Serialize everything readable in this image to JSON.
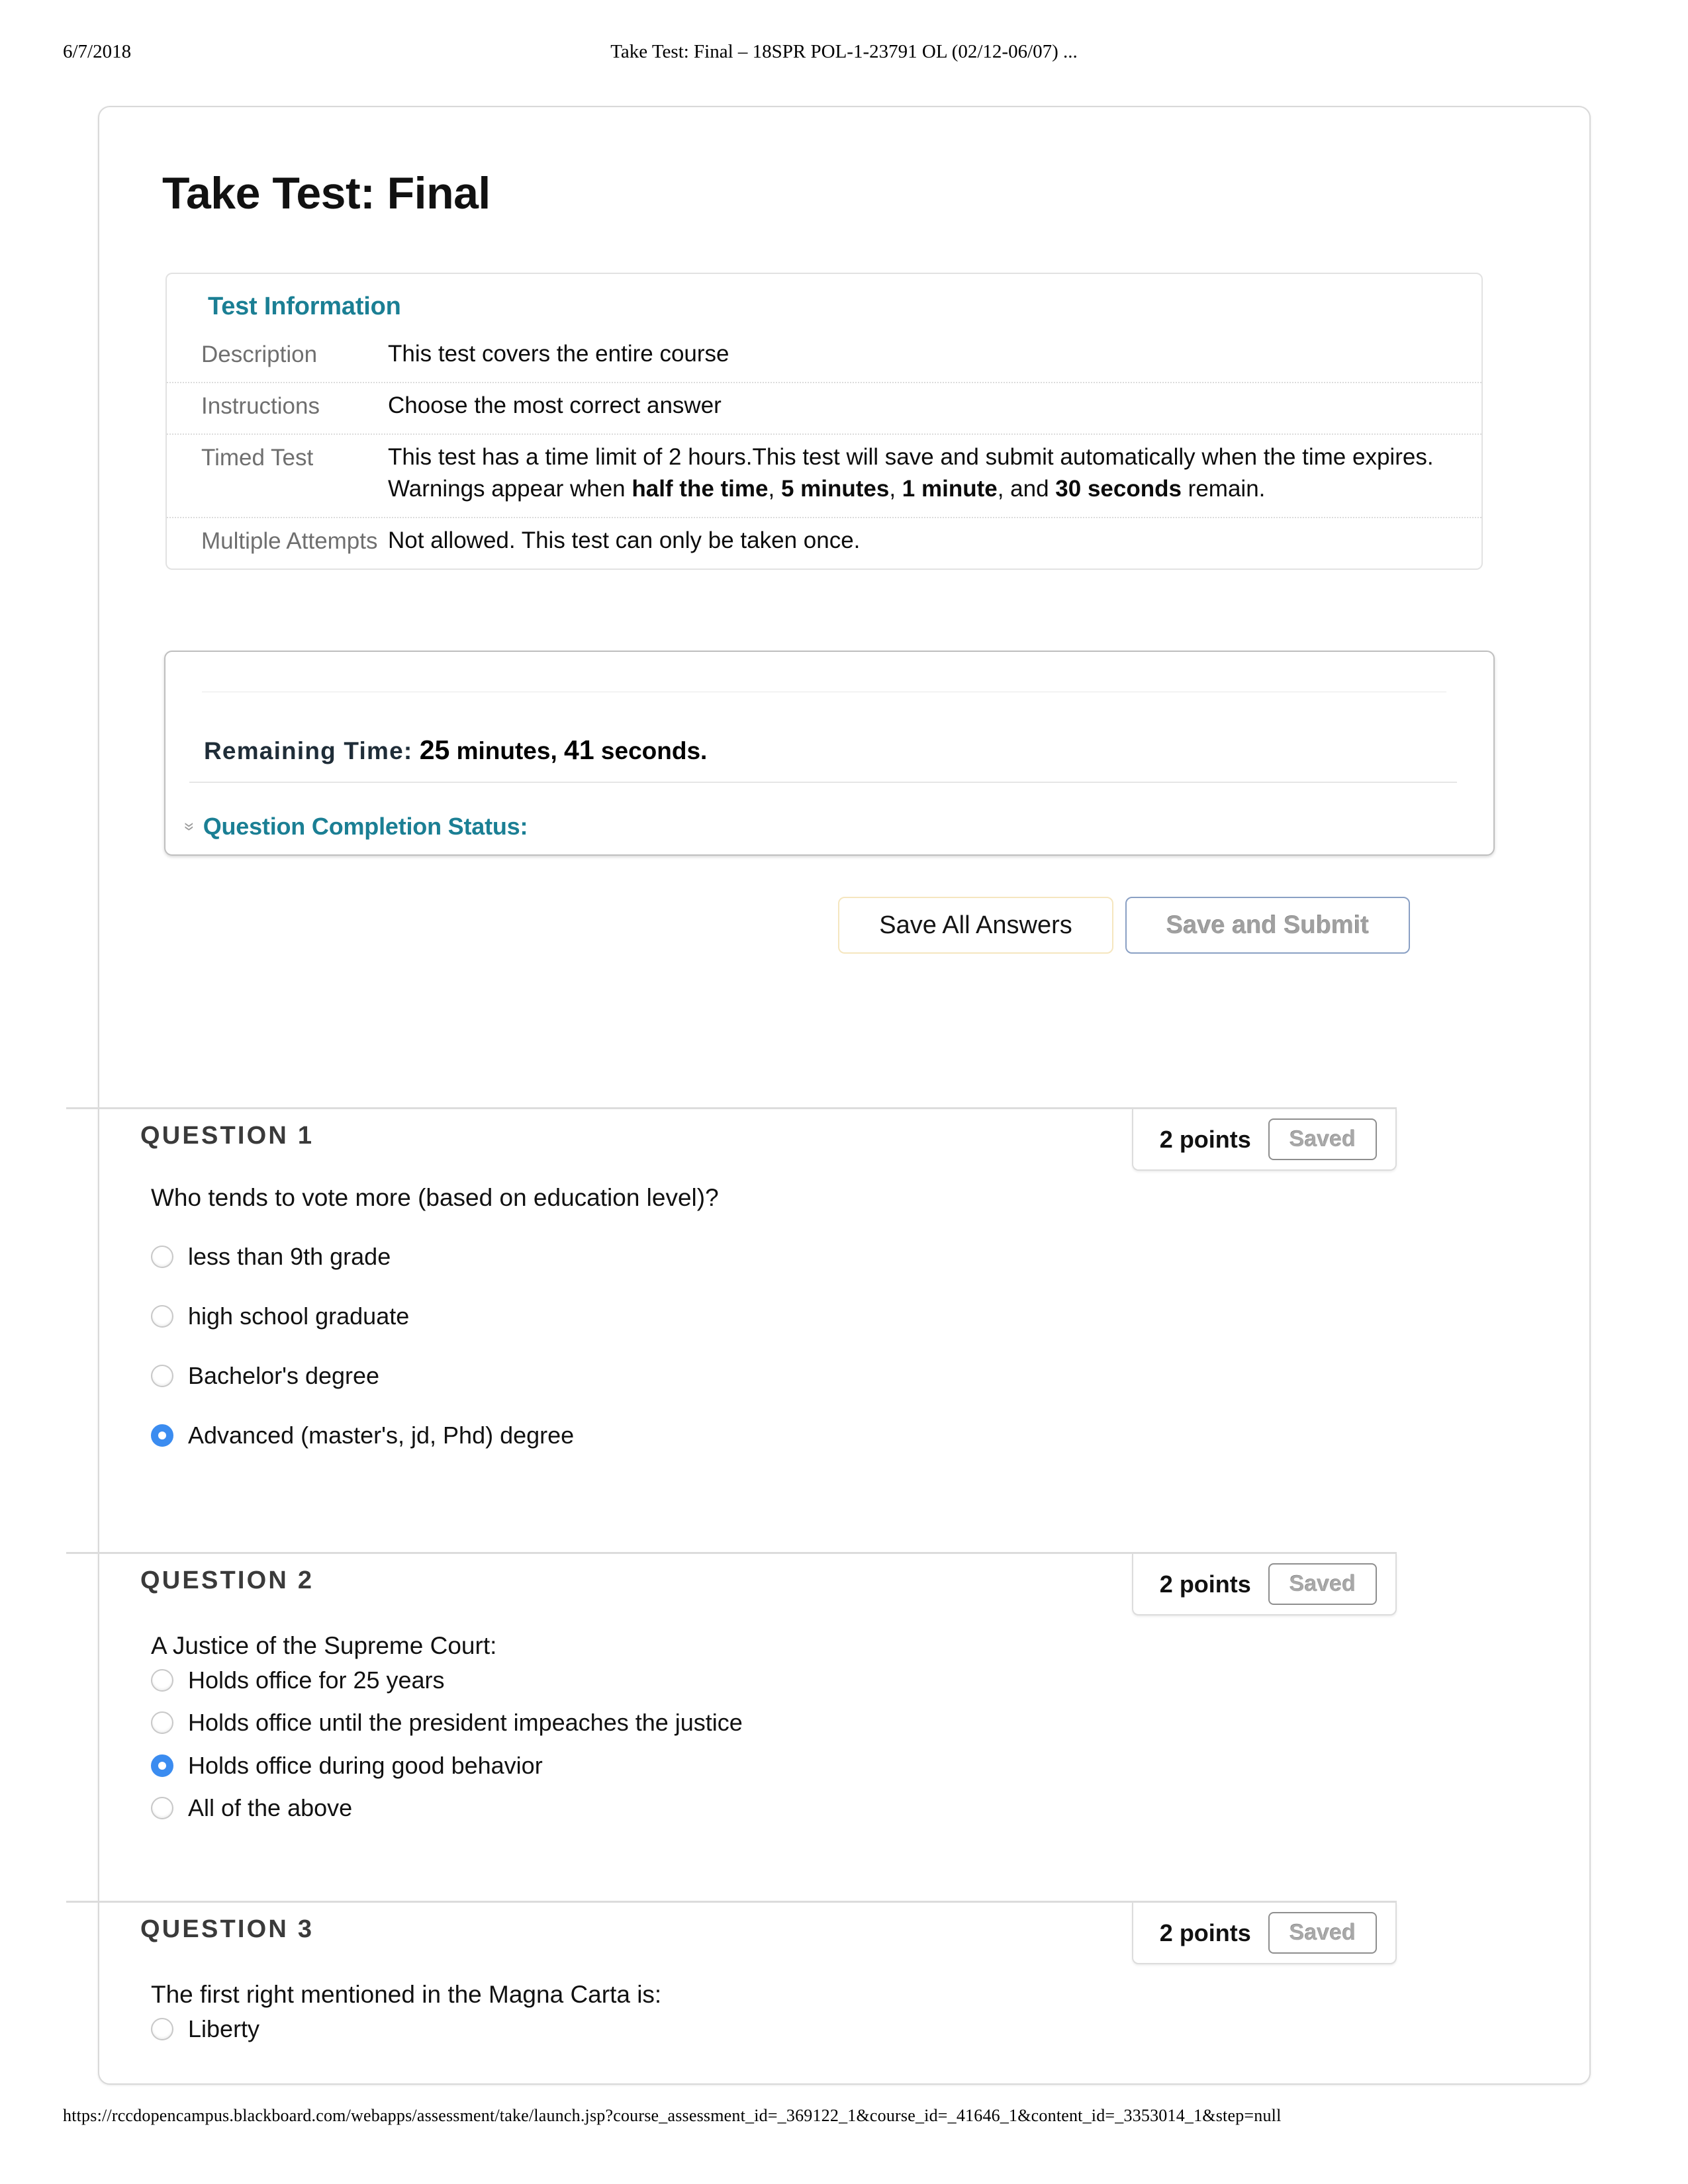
{
  "print_header": {
    "date": "6/7/2018",
    "title": "Take Test: Final – 18SPR POL-1-23791 OL (02/12-06/07) ..."
  },
  "print_footer": {
    "url": "https://rccdopencampus.blackboard.com/webapps/assessment/take/launch.jsp?course_assessment_id=_369122_1&course_id=_41646_1&content_id=_3353014_1&step=null"
  },
  "page": {
    "title": "Take Test: Final"
  },
  "test_information": {
    "heading": "Test Information",
    "rows": [
      {
        "label": "Description",
        "value": "This test covers the entire course"
      },
      {
        "label": "Instructions",
        "value": "Choose the most correct answer"
      },
      {
        "label": "Timed Test",
        "value": ""
      },
      {
        "label": "Multiple Attempts",
        "value": "Not allowed. This test can only be taken once."
      }
    ],
    "timed_test": {
      "label": "Timed Test",
      "line1": "This test has a time limit of 2 hours.This test will save and submit automatically when the",
      "line2": "time expires.",
      "warning_prefix": "Warnings appear when ",
      "warning_b1": "half the time",
      "warning_sep1": ", ",
      "warning_b2": "5 minutes",
      "warning_sep2": ", ",
      "warning_b3": "1 minute",
      "warning_sep3": ", and ",
      "warning_b4": "30 seconds",
      "warning_suffix": " remain."
    }
  },
  "timer": {
    "remaining_label": "Remaining Time:",
    "remaining_minutes_num": "25",
    "remaining_minutes_word": " minutes, ",
    "remaining_seconds_num": "41",
    "remaining_seconds_word": " seconds.",
    "completion_status_label": "Question Completion Status:",
    "chevron_icon": "»"
  },
  "actions": {
    "save_all_label": "Save All Answers",
    "save_submit_label": "Save and Submit"
  },
  "colors": {
    "accent_teal": "#1b7f94",
    "radio_selected_blue": "#3b8cf0",
    "save_all_border": "#f5e6bf",
    "save_submit_border": "#8aa0c4"
  },
  "questions": [
    {
      "number": "QUESTION 1",
      "points": "2 points",
      "saved": "Saved",
      "prompt": "Who tends to vote more (based on education level)?",
      "spacing": "wide",
      "options": [
        {
          "label": "less than 9th grade",
          "checked": false
        },
        {
          "label": "high school graduate",
          "checked": false
        },
        {
          "label": "Bachelor's degree",
          "checked": false
        },
        {
          "label": "Advanced (master's, jd, Phd) degree",
          "checked": true
        }
      ]
    },
    {
      "number": "QUESTION 2",
      "points": "2 points",
      "saved": "Saved",
      "prompt": "A Justice of the Supreme Court:",
      "spacing": "tight",
      "options": [
        {
          "label": "Holds office for 25 years",
          "checked": false
        },
        {
          "label": "Holds office until the president impeaches the justice",
          "checked": false
        },
        {
          "label": "Holds office during good behavior",
          "checked": true
        },
        {
          "label": "All of the above",
          "checked": false
        }
      ]
    },
    {
      "number": "QUESTION 3",
      "points": "2 points",
      "saved": "Saved",
      "prompt": "The first right mentioned in the Magna Carta is:",
      "spacing": "tight",
      "options": [
        {
          "label": "Liberty",
          "checked": false
        }
      ]
    }
  ]
}
